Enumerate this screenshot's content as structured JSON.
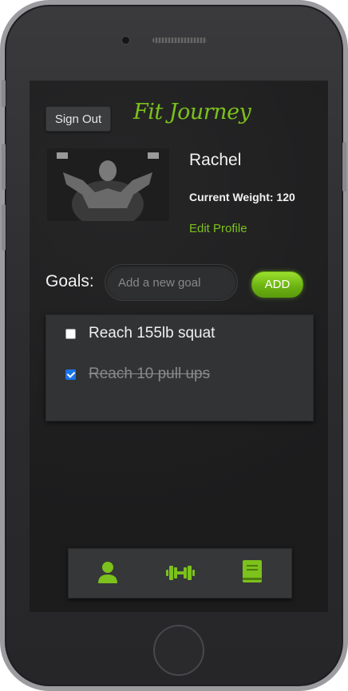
{
  "app": {
    "title": "Fit Journey",
    "accent_color": "#7cc11c"
  },
  "header": {
    "signout_label": "Sign Out"
  },
  "profile": {
    "name": "Rachel",
    "weight_label": "Current Weight: 120",
    "edit_label": "Edit Profile"
  },
  "goals": {
    "label": "Goals:",
    "input_placeholder": "Add a new goal",
    "add_label": "ADD",
    "items": [
      {
        "text": "Reach 155lb squat",
        "checked": false
      },
      {
        "text": "Reach 10 pull ups",
        "checked": true
      }
    ]
  },
  "nav": {
    "icons": [
      "user-icon",
      "dumbbell-icon",
      "book-icon"
    ]
  }
}
